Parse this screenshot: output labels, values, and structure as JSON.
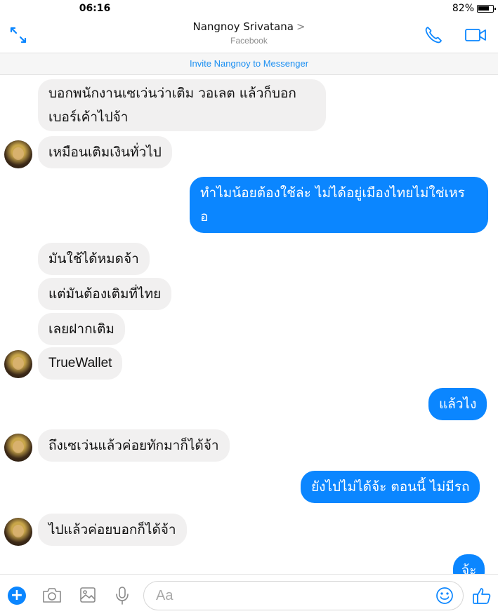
{
  "status": {
    "time": "06:16",
    "battery": "82%"
  },
  "header": {
    "contact_name": "Nangnoy Srivatana",
    "chevron": ">",
    "subtitle": "Facebook"
  },
  "invite": {
    "label": "Invite Nangnoy to Messenger"
  },
  "messages": [
    {
      "side": "in",
      "lines": [
        "บอกพนักงานเซเว่นว่าเติม วอเลต แล้วก็บอก",
        "เบอร์เค้าไปจ้า"
      ]
    },
    {
      "side": "in",
      "lines": [
        "เหมือนเติมเงินทั่วไป"
      ]
    },
    {
      "side": "out",
      "lines": [
        "ทำไมน้อยต้องใช้ล่ะ ไม่ได้อยู่เมืองไทยไม่ใช่เหร",
        "อ"
      ]
    },
    {
      "side": "in",
      "lines": [
        "มันใช้ได้หมดจ้า"
      ]
    },
    {
      "side": "in",
      "lines": [
        "แต่มันต้องเติมที่ไทย"
      ]
    },
    {
      "side": "in",
      "lines": [
        "เลยฝากเติม"
      ]
    },
    {
      "side": "in",
      "lines": [
        "TrueWallet"
      ]
    },
    {
      "side": "out",
      "lines": [
        "แล้วไง"
      ]
    },
    {
      "side": "in",
      "lines": [
        "ถึงเซเว่นแล้วค่อยทักมาก็ได้จ้า"
      ]
    },
    {
      "side": "out",
      "lines": [
        "ยังไปไม่ได้จ้ะ ตอนนี้ ไม่มีรถ"
      ]
    },
    {
      "side": "in",
      "lines": [
        "ไปแล้วค่อยบอกก็ได้จ้า"
      ]
    },
    {
      "side": "out",
      "lines": [
        "จ้ะ"
      ]
    }
  ],
  "composer": {
    "plus": "+",
    "placeholder": "Aa",
    "icons": [
      "plus-icon",
      "camera-icon",
      "image-icon",
      "microphone-icon",
      "emoji-icon",
      "thumbs-up-icon"
    ]
  },
  "colors": {
    "accent": "#0b86ff",
    "incoming_bubble": "#f1f0f0",
    "link": "#1b8ff2"
  }
}
